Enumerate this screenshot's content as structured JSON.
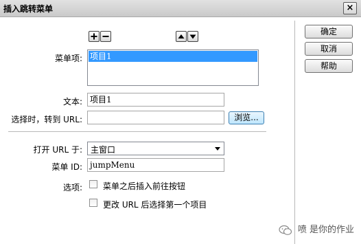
{
  "window": {
    "title": "插入跳转菜单",
    "close_glyph": "×"
  },
  "toolbar": {
    "add_icon": "plus-icon",
    "remove_icon": "minus-icon",
    "up_icon": "arrow-up-icon",
    "down_icon": "arrow-down-icon"
  },
  "buttons": {
    "ok": "确定",
    "cancel": "取消",
    "help": "帮助",
    "browse": "浏览..."
  },
  "menu_items": {
    "label": "菜单项:",
    "items": [
      "项目1"
    ],
    "selected": "项目1"
  },
  "text_field": {
    "label": "文本:",
    "value": "项目1"
  },
  "url_field": {
    "label": "选择时，转到 URL:",
    "value": ""
  },
  "open_url_in": {
    "label": "打开 URL 于:",
    "selected": "主窗口"
  },
  "menu_id": {
    "label": "菜单 ID:",
    "value": "jumpMenu"
  },
  "options": {
    "label": "选项:",
    "insert_go_button": {
      "label": "菜单之后插入前往按钮",
      "checked": false
    },
    "select_first_item": {
      "label": "更改 URL 后选择第一个项目",
      "checked": false
    }
  },
  "watermark": {
    "text": "喷  是你的作业"
  },
  "colors": {
    "selection": "#3399ff",
    "titlebar": "#d4d4d4"
  }
}
